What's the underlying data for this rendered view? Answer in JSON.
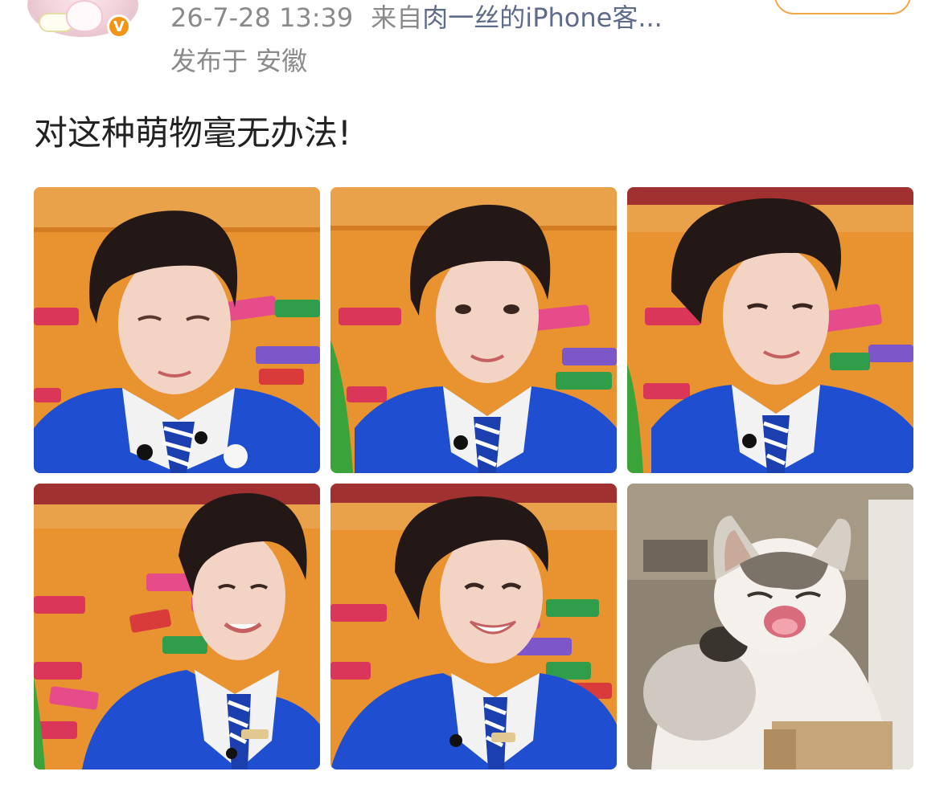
{
  "post": {
    "author_avatar": "user-avatar",
    "verified_badge": "V",
    "timestamp": "26-7-28 13:39",
    "source_prefix": "来自",
    "source_client": "肉一丝的iPhone客...",
    "location": "发布于 安徽",
    "text": "对这种萌物毫无办法!"
  },
  "images": [
    {
      "name": "photo-1",
      "subject": "boy-in-blue-jacket-looking-down"
    },
    {
      "name": "photo-2",
      "subject": "boy-in-blue-jacket-smiling"
    },
    {
      "name": "photo-3",
      "subject": "boy-in-blue-jacket-side-smile"
    },
    {
      "name": "photo-4",
      "subject": "boy-in-blue-jacket-smiling-center"
    },
    {
      "name": "photo-5",
      "subject": "boy-in-blue-jacket-laughing"
    },
    {
      "name": "photo-6",
      "subject": "laughing-kitten"
    }
  ],
  "colors": {
    "verified": "#f19417",
    "meta_text": "#8a8a8a",
    "body_text": "#222222",
    "follow_border": "#f2a64a",
    "jacket_blue": "#1f4fd0",
    "backdrop_orange": "#e6922f"
  }
}
